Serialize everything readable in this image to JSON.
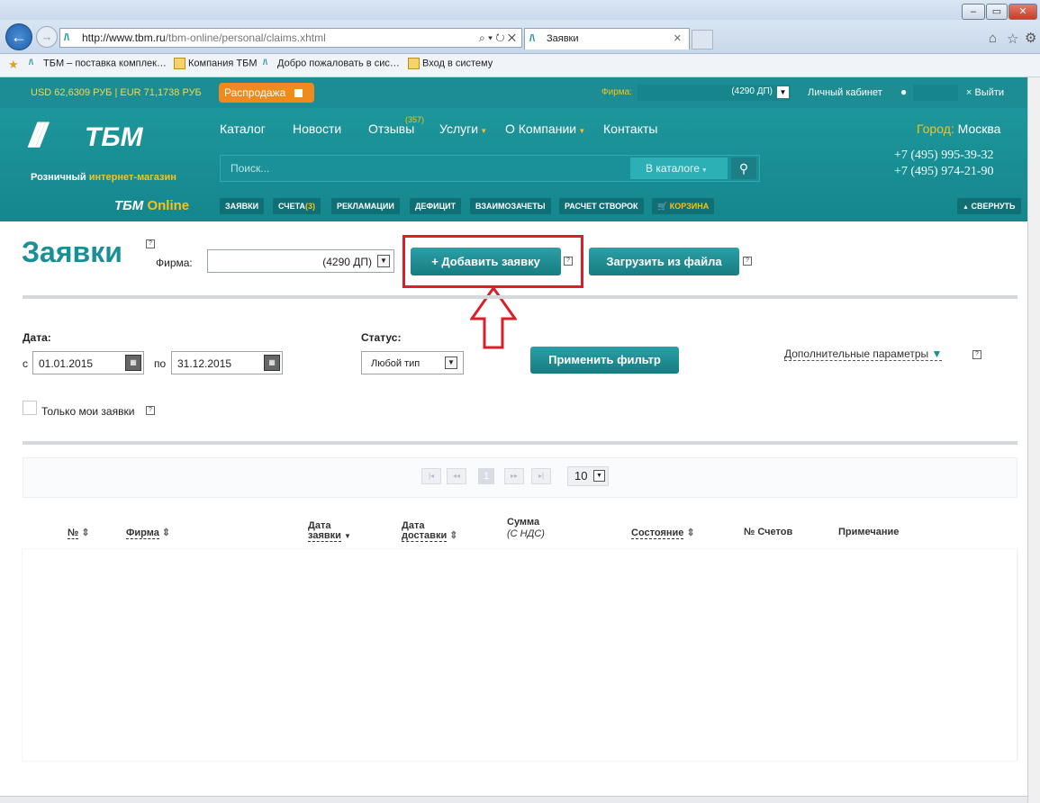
{
  "browser": {
    "url_prefix": "http://www.tbm.ru",
    "url_path": "/tbm-online/personal/claims.xhtml",
    "search_controls": "⌕ ▾ ↻ ✕",
    "tab_title": "Заявки",
    "favorites": [
      "ТБМ – поставка комплек…",
      "Компания ТБМ",
      "Добро пожаловать в сис…",
      "Вход в систему"
    ]
  },
  "header": {
    "currency": "USD 62,6309 РУБ | EUR 71,1738 РУБ",
    "sale_button": "Распродажа",
    "firm_label": "Фирма:",
    "firm_value": "(4290 ДП)",
    "cabinet": "Личный кабинет",
    "logout": "× Выйти",
    "logo_text": "ТБМ",
    "logo_tagline_1": "Розничный",
    "logo_tagline_2": "интернет-магазин",
    "online_brand_1": "ТБМ",
    "online_brand_2": "Online",
    "menu": [
      "Каталог",
      "Новости",
      "Отзывы",
      "Услуги",
      "О Компании",
      "Контакты"
    ],
    "reviews_badge": "(357)",
    "city_label": "Город:",
    "city_value": "Москва",
    "phone1": "+7 (495) 995-39-32",
    "phone2": "+7 (495) 974-21-90",
    "search_placeholder": "Поиск...",
    "search_scope": "В каталоге",
    "subtabs": [
      "ЗАЯВКИ",
      "СЧЕТА",
      "(3)",
      "РЕКЛАМАЦИИ",
      "ДЕФИЦИТ",
      "ВЗАИМОЗАЧЕТЫ",
      "РАСЧЕТ СТВОРОК",
      "КОРЗИНА"
    ],
    "collapse": "СВЕРНУТЬ"
  },
  "page": {
    "title": "Заявки",
    "firm_label": "Фирма:",
    "firm_value": "(4290 ДП)",
    "add_button": "+ Добавить заявку",
    "upload_button": "Загрузить из файла",
    "date_label": "Дата:",
    "from_label": "с",
    "date_from": "01.01.2015",
    "to_label": "по",
    "date_to": "31.12.2015",
    "status_label": "Статус:",
    "status_value": "Любой тип",
    "apply_button": "Применить фильтр",
    "extra_params": "Дополнительные параметры",
    "only_mine": "Только мои заявки",
    "page_number": "1",
    "page_size": "10",
    "columns": {
      "num": "№",
      "firm": "Фирма",
      "date_order_1": "Дата",
      "date_order_2": "заявки",
      "date_delivery_1": "Дата",
      "date_delivery_2": "доставки",
      "sum_1": "Сумма",
      "sum_2": "(С НДС)",
      "state": "Состояние",
      "invoice_no": "№ Счетов",
      "note": "Примечание"
    }
  },
  "colors": {
    "teal": "#1a8f95",
    "orange": "#f08a1c",
    "highlight_red": "#d9202a",
    "gold": "#f7c21a"
  }
}
